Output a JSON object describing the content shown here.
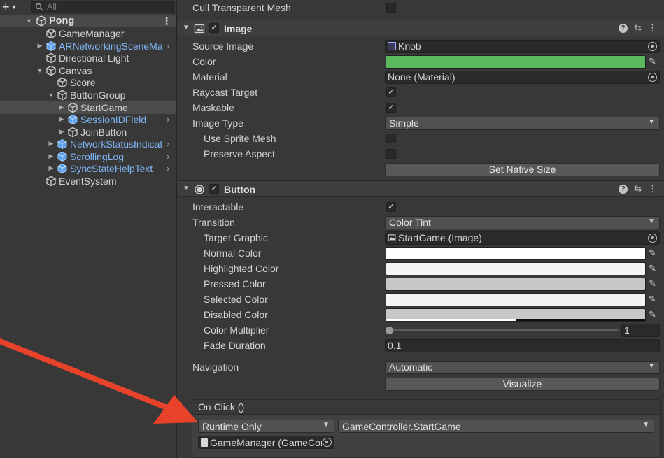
{
  "hierarchy": {
    "search_placeholder": "All",
    "scene_name": "Pong",
    "items": [
      {
        "label": "GameManager"
      },
      {
        "label": "ARNetworkingSceneMa"
      },
      {
        "label": "Directional Light"
      },
      {
        "label": "Canvas"
      },
      {
        "label": "Score"
      },
      {
        "label": "ButtonGroup"
      },
      {
        "label": "StartGame"
      },
      {
        "label": "SessionIDField"
      },
      {
        "label": "JoinButton"
      },
      {
        "label": "NetworkStatusIndicat"
      },
      {
        "label": "ScrollingLog"
      },
      {
        "label": "SyncStateHelpText"
      },
      {
        "label": "EventSystem"
      }
    ]
  },
  "inspector": {
    "cull_transparent_mesh": "Cull Transparent Mesh",
    "image": {
      "title": "Image",
      "source_image_label": "Source Image",
      "source_image_value": "Knob",
      "color_label": "Color",
      "color_value": "#5cb85c",
      "material_label": "Material",
      "material_value": "None (Material)",
      "raycast_target_label": "Raycast Target",
      "maskable_label": "Maskable",
      "image_type_label": "Image Type",
      "image_type_value": "Simple",
      "use_sprite_mesh_label": "Use Sprite Mesh",
      "preserve_aspect_label": "Preserve Aspect",
      "set_native_size": "Set Native Size"
    },
    "button": {
      "title": "Button",
      "interactable_label": "Interactable",
      "transition_label": "Transition",
      "transition_value": "Color Tint",
      "target_graphic_label": "Target Graphic",
      "target_graphic_value": "StartGame (Image)",
      "normal_color_label": "Normal Color",
      "highlighted_color_label": "Highlighted Color",
      "pressed_color_label": "Pressed Color",
      "selected_color_label": "Selected Color",
      "disabled_color_label": "Disabled Color",
      "color_multiplier_label": "Color Multiplier",
      "color_multiplier_value": "1",
      "fade_duration_label": "Fade Duration",
      "fade_duration_value": "0.1",
      "navigation_label": "Navigation",
      "navigation_value": "Automatic",
      "visualize": "Visualize",
      "on_click_label": "On Click ()",
      "runtime_value": "Runtime Only",
      "function_value": "GameController.StartGame",
      "object_value": "GameManager (GameCor"
    }
  },
  "colors": {
    "annotation_arrow": "#e8422a",
    "prefab_text": "#7fb5f5",
    "image_color": "#5cb85c"
  }
}
